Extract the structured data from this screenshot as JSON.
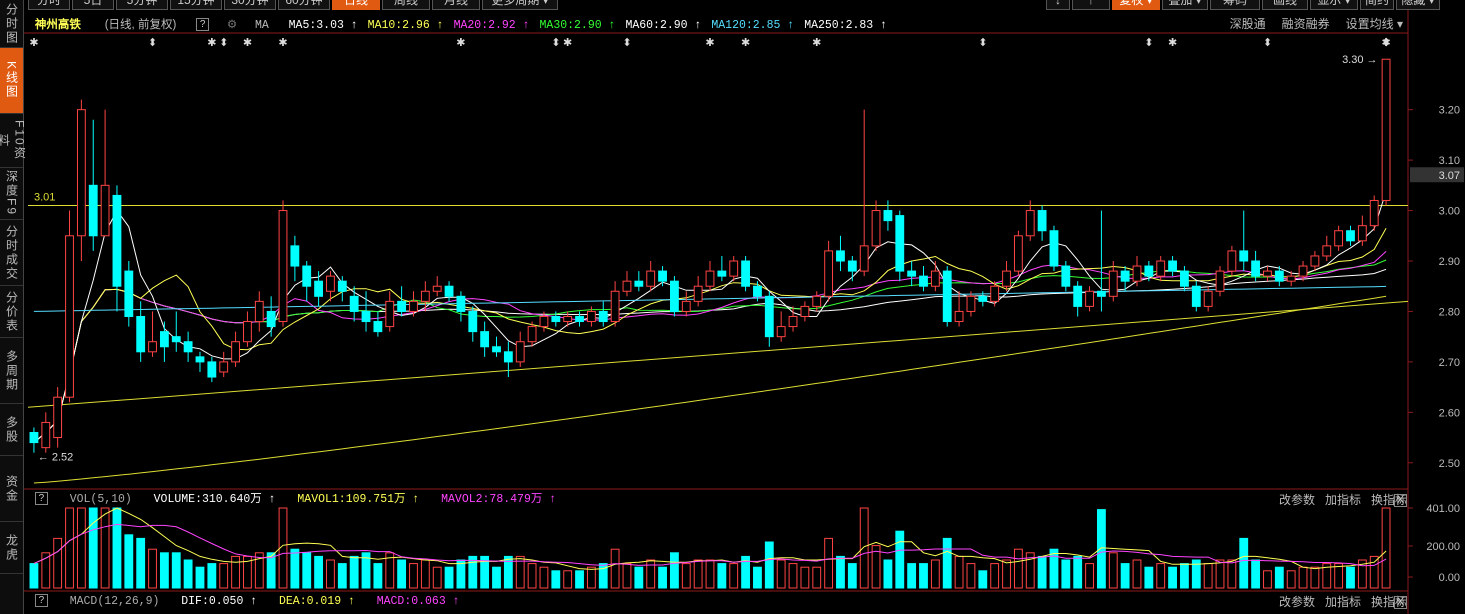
{
  "left_tabs": [
    {
      "label": "分时图",
      "active": false
    },
    {
      "label": "K线图",
      "active": true
    },
    {
      "label": "F10资料",
      "active": false
    },
    {
      "label": "深度F9",
      "active": false
    },
    {
      "label": "分时成交",
      "active": false
    },
    {
      "label": "分价表",
      "active": false
    },
    {
      "label": "多周期",
      "active": false
    },
    {
      "label": "多股",
      "active": false
    },
    {
      "label": "资金",
      "active": false
    },
    {
      "label": "龙虎",
      "active": false
    }
  ],
  "period_tabs": [
    {
      "label": "分时",
      "active": false
    },
    {
      "label": "5日",
      "active": false
    },
    {
      "label": "5分钟",
      "active": false
    },
    {
      "label": "15分钟",
      "active": false
    },
    {
      "label": "30分钟",
      "active": false
    },
    {
      "label": "60分钟",
      "active": false
    },
    {
      "label": "日线",
      "active": true
    },
    {
      "label": "周线",
      "active": false
    },
    {
      "label": "月线",
      "active": false
    },
    {
      "label": "更多周期 ▾",
      "active": false
    }
  ],
  "right_buttons": [
    {
      "label": "↓",
      "active": false
    },
    {
      "label": "↑",
      "active": false
    },
    {
      "label": "复权 ▾",
      "active": true
    },
    {
      "label": "叠加 ▾",
      "active": false
    },
    {
      "label": "筹码",
      "active": false
    },
    {
      "label": "画线",
      "active": false
    },
    {
      "label": "显示 ▾",
      "active": false
    },
    {
      "label": "简约",
      "active": false
    },
    {
      "label": "隐藏 ▾",
      "active": false
    }
  ],
  "stock": {
    "name": "神州高铁",
    "sub": "(日线, 前复权)",
    "help": "?",
    "ma_label": "MA",
    "mas": [
      {
        "text": "MA5:3.03 ↑",
        "color": "#ffffff"
      },
      {
        "text": "MA10:2.96 ↑",
        "color": "#ffff55"
      },
      {
        "text": "MA20:2.92 ↑",
        "color": "#ff44ff"
      },
      {
        "text": "MA30:2.90 ↑",
        "color": "#33ff33"
      },
      {
        "text": "MA60:2.90 ↑",
        "color": "#ffffff"
      },
      {
        "text": "MA120:2.85 ↑",
        "color": "#55ddff"
      },
      {
        "text": "MA250:2.83 ↑",
        "color": "#ffffff"
      }
    ]
  },
  "right_links": [
    "深股通",
    "融资融券",
    "设置均线 ▾"
  ],
  "price_axis": {
    "ticks": [
      "3.20",
      "3.10",
      "3.07",
      "3.00",
      "2.90",
      "2.80",
      "2.70",
      "2.60",
      "2.50"
    ],
    "current": "3.07"
  },
  "price_annotations": {
    "high": "3.30",
    "low": "2.52",
    "hline": "3.01"
  },
  "vol_bar": {
    "label": "VOL(5,10)",
    "volume": "VOLUME:310.640万 ↑",
    "mavol1": "MAVOL1:109.751万 ↑",
    "mavol2": "MAVOL2:78.479万 ↑",
    "axis": [
      "401.00",
      "200.00",
      "0.00"
    ]
  },
  "macd_bar": {
    "label": "MACD(12,26,9)",
    "dif": "DIF:0.050 ↑",
    "dea": "DEA:0.019 ↑",
    "macd": "MACD:0.063 ↑"
  },
  "indicator_buttons": [
    "改参数",
    "加指标",
    "换指标"
  ],
  "close_btn": "X",
  "colors": {
    "up": "#ff4444",
    "down": "#00ffff",
    "accent": "#e05a12"
  },
  "chart_data": {
    "type": "candlestick",
    "ylim": [
      2.45,
      3.35
    ],
    "candles": [
      {
        "o": 2.56,
        "c": 2.54,
        "h": 2.57,
        "l": 2.52
      },
      {
        "o": 2.53,
        "c": 2.58,
        "h": 2.6,
        "l": 2.52
      },
      {
        "o": 2.55,
        "c": 2.63,
        "h": 2.65,
        "l": 2.53
      },
      {
        "o": 2.63,
        "c": 2.95,
        "h": 3.0,
        "l": 2.62
      },
      {
        "o": 2.95,
        "c": 3.2,
        "h": 3.22,
        "l": 2.9
      },
      {
        "o": 3.05,
        "c": 2.95,
        "h": 3.18,
        "l": 2.92
      },
      {
        "o": 2.95,
        "c": 3.05,
        "h": 3.2,
        "l": 2.95
      },
      {
        "o": 3.03,
        "c": 2.85,
        "h": 3.05,
        "l": 2.8
      },
      {
        "o": 2.88,
        "c": 2.79,
        "h": 2.9,
        "l": 2.77
      },
      {
        "o": 2.79,
        "c": 2.72,
        "h": 2.82,
        "l": 2.7
      },
      {
        "o": 2.72,
        "c": 2.74,
        "h": 2.8,
        "l": 2.71
      },
      {
        "o": 2.76,
        "c": 2.73,
        "h": 2.78,
        "l": 2.7
      },
      {
        "o": 2.75,
        "c": 2.74,
        "h": 2.8,
        "l": 2.72
      },
      {
        "o": 2.74,
        "c": 2.72,
        "h": 2.76,
        "l": 2.7
      },
      {
        "o": 2.71,
        "c": 2.7,
        "h": 2.72,
        "l": 2.68
      },
      {
        "o": 2.7,
        "c": 2.67,
        "h": 2.71,
        "l": 2.66
      },
      {
        "o": 2.68,
        "c": 2.7,
        "h": 2.72,
        "l": 2.67
      },
      {
        "o": 2.7,
        "c": 2.74,
        "h": 2.76,
        "l": 2.69
      },
      {
        "o": 2.74,
        "c": 2.78,
        "h": 2.8,
        "l": 2.73
      },
      {
        "o": 2.78,
        "c": 2.82,
        "h": 2.84,
        "l": 2.76
      },
      {
        "o": 2.8,
        "c": 2.77,
        "h": 2.83,
        "l": 2.75
      },
      {
        "o": 2.78,
        "c": 3.0,
        "h": 3.02,
        "l": 2.77
      },
      {
        "o": 2.93,
        "c": 2.89,
        "h": 2.95,
        "l": 2.86
      },
      {
        "o": 2.89,
        "c": 2.85,
        "h": 2.9,
        "l": 2.82
      },
      {
        "o": 2.86,
        "c": 2.83,
        "h": 2.88,
        "l": 2.81
      },
      {
        "o": 2.84,
        "c": 2.87,
        "h": 2.88,
        "l": 2.82
      },
      {
        "o": 2.86,
        "c": 2.84,
        "h": 2.87,
        "l": 2.82
      },
      {
        "o": 2.83,
        "c": 2.8,
        "h": 2.85,
        "l": 2.78
      },
      {
        "o": 2.8,
        "c": 2.78,
        "h": 2.84,
        "l": 2.76
      },
      {
        "o": 2.78,
        "c": 2.76,
        "h": 2.8,
        "l": 2.75
      },
      {
        "o": 2.77,
        "c": 2.82,
        "h": 2.84,
        "l": 2.76
      },
      {
        "o": 2.82,
        "c": 2.8,
        "h": 2.85,
        "l": 2.79
      },
      {
        "o": 2.8,
        "c": 2.82,
        "h": 2.84,
        "l": 2.79
      },
      {
        "o": 2.82,
        "c": 2.84,
        "h": 2.86,
        "l": 2.8
      },
      {
        "o": 2.84,
        "c": 2.85,
        "h": 2.87,
        "l": 2.83
      },
      {
        "o": 2.85,
        "c": 2.83,
        "h": 2.86,
        "l": 2.82
      },
      {
        "o": 2.83,
        "c": 2.8,
        "h": 2.84,
        "l": 2.78
      },
      {
        "o": 2.8,
        "c": 2.76,
        "h": 2.81,
        "l": 2.74
      },
      {
        "o": 2.76,
        "c": 2.73,
        "h": 2.78,
        "l": 2.71
      },
      {
        "o": 2.73,
        "c": 2.72,
        "h": 2.75,
        "l": 2.71
      },
      {
        "o": 2.72,
        "c": 2.7,
        "h": 2.74,
        "l": 2.67
      },
      {
        "o": 2.7,
        "c": 2.74,
        "h": 2.76,
        "l": 2.69
      },
      {
        "o": 2.74,
        "c": 2.77,
        "h": 2.78,
        "l": 2.73
      },
      {
        "o": 2.77,
        "c": 2.79,
        "h": 2.8,
        "l": 2.76
      },
      {
        "o": 2.79,
        "c": 2.78,
        "h": 2.8,
        "l": 2.77
      },
      {
        "o": 2.78,
        "c": 2.79,
        "h": 2.8,
        "l": 2.77
      },
      {
        "o": 2.79,
        "c": 2.78,
        "h": 2.8,
        "l": 2.77
      },
      {
        "o": 2.78,
        "c": 2.8,
        "h": 2.81,
        "l": 2.77
      },
      {
        "o": 2.8,
        "c": 2.78,
        "h": 2.82,
        "l": 2.77
      },
      {
        "o": 2.78,
        "c": 2.84,
        "h": 2.86,
        "l": 2.77
      },
      {
        "o": 2.84,
        "c": 2.86,
        "h": 2.88,
        "l": 2.83
      },
      {
        "o": 2.86,
        "c": 2.85,
        "h": 2.88,
        "l": 2.84
      },
      {
        "o": 2.85,
        "c": 2.88,
        "h": 2.9,
        "l": 2.84
      },
      {
        "o": 2.88,
        "c": 2.86,
        "h": 2.89,
        "l": 2.85
      },
      {
        "o": 2.86,
        "c": 2.8,
        "h": 2.87,
        "l": 2.79
      },
      {
        "o": 2.8,
        "c": 2.82,
        "h": 2.84,
        "l": 2.79
      },
      {
        "o": 2.82,
        "c": 2.85,
        "h": 2.87,
        "l": 2.81
      },
      {
        "o": 2.85,
        "c": 2.88,
        "h": 2.9,
        "l": 2.84
      },
      {
        "o": 2.88,
        "c": 2.87,
        "h": 2.91,
        "l": 2.86
      },
      {
        "o": 2.87,
        "c": 2.9,
        "h": 2.91,
        "l": 2.86
      },
      {
        "o": 2.9,
        "c": 2.85,
        "h": 2.91,
        "l": 2.84
      },
      {
        "o": 2.85,
        "c": 2.83,
        "h": 2.86,
        "l": 2.82
      },
      {
        "o": 2.83,
        "c": 2.75,
        "h": 2.84,
        "l": 2.73
      },
      {
        "o": 2.75,
        "c": 2.77,
        "h": 2.8,
        "l": 2.74
      },
      {
        "o": 2.77,
        "c": 2.79,
        "h": 2.81,
        "l": 2.76
      },
      {
        "o": 2.79,
        "c": 2.81,
        "h": 2.82,
        "l": 2.78
      },
      {
        "o": 2.81,
        "c": 2.83,
        "h": 2.84,
        "l": 2.8
      },
      {
        "o": 2.83,
        "c": 2.92,
        "h": 2.94,
        "l": 2.82
      },
      {
        "o": 2.92,
        "c": 2.9,
        "h": 2.95,
        "l": 2.88
      },
      {
        "o": 2.9,
        "c": 2.88,
        "h": 2.91,
        "l": 2.86
      },
      {
        "o": 2.88,
        "c": 2.93,
        "h": 3.2,
        "l": 2.87
      },
      {
        "o": 2.93,
        "c": 3.0,
        "h": 3.02,
        "l": 2.92
      },
      {
        "o": 3.0,
        "c": 2.98,
        "h": 3.02,
        "l": 2.96
      },
      {
        "o": 2.99,
        "c": 2.88,
        "h": 3.0,
        "l": 2.86
      },
      {
        "o": 2.88,
        "c": 2.87,
        "h": 2.9,
        "l": 2.85
      },
      {
        "o": 2.87,
        "c": 2.85,
        "h": 2.89,
        "l": 2.84
      },
      {
        "o": 2.85,
        "c": 2.88,
        "h": 2.9,
        "l": 2.84
      },
      {
        "o": 2.88,
        "c": 2.78,
        "h": 2.89,
        "l": 2.77
      },
      {
        "o": 2.78,
        "c": 2.8,
        "h": 2.84,
        "l": 2.77
      },
      {
        "o": 2.8,
        "c": 2.83,
        "h": 2.84,
        "l": 2.79
      },
      {
        "o": 2.83,
        "c": 2.82,
        "h": 2.84,
        "l": 2.81
      },
      {
        "o": 2.82,
        "c": 2.85,
        "h": 2.86,
        "l": 2.81
      },
      {
        "o": 2.85,
        "c": 2.88,
        "h": 2.9,
        "l": 2.84
      },
      {
        "o": 2.88,
        "c": 2.95,
        "h": 2.96,
        "l": 2.87
      },
      {
        "o": 2.95,
        "c": 3.0,
        "h": 3.02,
        "l": 2.94
      },
      {
        "o": 3.0,
        "c": 2.96,
        "h": 3.01,
        "l": 2.94
      },
      {
        "o": 2.96,
        "c": 2.89,
        "h": 2.97,
        "l": 2.88
      },
      {
        "o": 2.89,
        "c": 2.85,
        "h": 2.9,
        "l": 2.84
      },
      {
        "o": 2.85,
        "c": 2.81,
        "h": 2.86,
        "l": 2.79
      },
      {
        "o": 2.81,
        "c": 2.84,
        "h": 2.85,
        "l": 2.8
      },
      {
        "o": 2.84,
        "c": 2.83,
        "h": 3.0,
        "l": 2.8
      },
      {
        "o": 2.83,
        "c": 2.88,
        "h": 2.9,
        "l": 2.82
      },
      {
        "o": 2.88,
        "c": 2.86,
        "h": 2.89,
        "l": 2.84
      },
      {
        "o": 2.86,
        "c": 2.89,
        "h": 2.91,
        "l": 2.85
      },
      {
        "o": 2.89,
        "c": 2.87,
        "h": 2.9,
        "l": 2.86
      },
      {
        "o": 2.87,
        "c": 2.9,
        "h": 2.91,
        "l": 2.86
      },
      {
        "o": 2.9,
        "c": 2.88,
        "h": 2.91,
        "l": 2.87
      },
      {
        "o": 2.88,
        "c": 2.85,
        "h": 2.89,
        "l": 2.84
      },
      {
        "o": 2.85,
        "c": 2.81,
        "h": 2.86,
        "l": 2.8
      },
      {
        "o": 2.81,
        "c": 2.84,
        "h": 2.85,
        "l": 2.8
      },
      {
        "o": 2.84,
        "c": 2.88,
        "h": 2.89,
        "l": 2.83
      },
      {
        "o": 2.88,
        "c": 2.92,
        "h": 2.93,
        "l": 2.87
      },
      {
        "o": 2.92,
        "c": 2.9,
        "h": 3.0,
        "l": 2.88
      },
      {
        "o": 2.9,
        "c": 2.87,
        "h": 2.92,
        "l": 2.86
      },
      {
        "o": 2.87,
        "c": 2.88,
        "h": 2.89,
        "l": 2.86
      },
      {
        "o": 2.88,
        "c": 2.86,
        "h": 2.89,
        "l": 2.85
      },
      {
        "o": 2.86,
        "c": 2.87,
        "h": 2.88,
        "l": 2.85
      },
      {
        "o": 2.87,
        "c": 2.89,
        "h": 2.9,
        "l": 2.86
      },
      {
        "o": 2.89,
        "c": 2.91,
        "h": 2.92,
        "l": 2.88
      },
      {
        "o": 2.91,
        "c": 2.93,
        "h": 2.95,
        "l": 2.9
      },
      {
        "o": 2.93,
        "c": 2.96,
        "h": 2.97,
        "l": 2.92
      },
      {
        "o": 2.96,
        "c": 2.94,
        "h": 2.97,
        "l": 2.93
      },
      {
        "o": 2.94,
        "c": 2.97,
        "h": 2.99,
        "l": 2.93
      },
      {
        "o": 2.97,
        "c": 3.02,
        "h": 3.03,
        "l": 2.96
      },
      {
        "o": 3.02,
        "c": 3.3,
        "h": 3.3,
        "l": 3.01
      }
    ]
  }
}
